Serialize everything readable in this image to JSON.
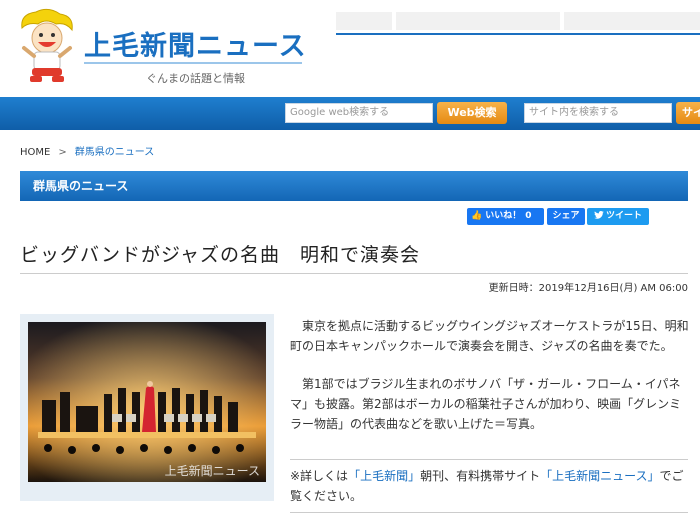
{
  "site": {
    "logo_text": "上毛新聞ニュース",
    "tagline": "ぐんまの話題と情報"
  },
  "search": {
    "google_placeholder": "Google web検索する",
    "web_button": "Web検索",
    "site_placeholder": "サイト内を検索する",
    "site_button": "サイ"
  },
  "breadcrumb": {
    "home": "HOME",
    "separator": ">",
    "current": "群馬県のニュース"
  },
  "section": {
    "title": "群馬県のニュース"
  },
  "social": {
    "like_label": "いいね！",
    "like_count": "0",
    "share_label": "シェア",
    "tweet_label": "ツイート"
  },
  "article": {
    "title": "ビッグバンドがジャズの名曲　明和で演奏会",
    "updated": "更新日時：2019年12月16日(月) AM 06:00",
    "paragraph1": "東京を拠点に活動するビッグウイングジャズオーケストラが15日、明和町の日本キャンパックホールで演奏会を開き、ジャズの名曲を奏でた。",
    "paragraph2": "第1部ではブラジル生まれのボサノバ「ザ・ガール・フローム・イパネマ」も披露。第2部はボーカルの稲葉社子さんが加わり、映画「グレンミラー物語」の代表曲などを歌い上げた＝写真。",
    "note_prefix": "※詳しくは",
    "note_link1": "「上毛新聞」",
    "note_mid": "朝刊、有料携帯サイト",
    "note_link2": "「上毛新聞ニュース」",
    "note_suffix": "でご覧ください。",
    "photo_watermark": "上毛新聞ニュース"
  },
  "colors": {
    "brand_blue": "#1a6fc0",
    "search_button_orange": "#ef9a2a",
    "facebook_blue": "#1877f2",
    "twitter_blue": "#1d9bf0"
  }
}
